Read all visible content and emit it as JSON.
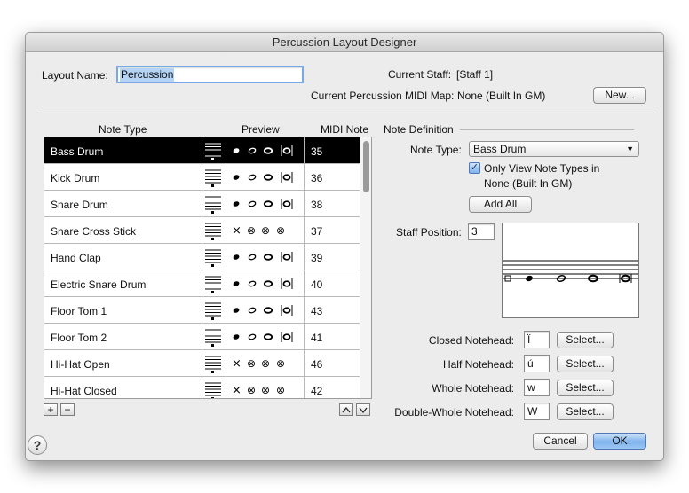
{
  "window": {
    "title": "Percussion Layout Designer"
  },
  "layout_name": {
    "label": "Layout Name:",
    "value": "Percussion"
  },
  "current_staff": {
    "label": "Current Staff:",
    "value": "[Staff 1]"
  },
  "midi_map": {
    "label": "Current Percussion MIDI Map:",
    "value": "None (Built In GM)",
    "new_button": "New..."
  },
  "table": {
    "headers": {
      "note_type": "Note Type",
      "preview": "Preview",
      "midi_note": "MIDI Note"
    },
    "rows": [
      {
        "name": "Bass Drum",
        "midi": "35",
        "preview": "normal",
        "selected": true
      },
      {
        "name": "Kick Drum",
        "midi": "36",
        "preview": "normal",
        "selected": false
      },
      {
        "name": "Snare Drum",
        "midi": "38",
        "preview": "normal",
        "selected": false
      },
      {
        "name": "Snare Cross Stick",
        "midi": "37",
        "preview": "x",
        "selected": false
      },
      {
        "name": "Hand Clap",
        "midi": "39",
        "preview": "normal",
        "selected": false
      },
      {
        "name": "Electric Snare Drum",
        "midi": "40",
        "preview": "normal",
        "selected": false
      },
      {
        "name": "Floor Tom 1",
        "midi": "43",
        "preview": "normal",
        "selected": false
      },
      {
        "name": "Floor Tom 2",
        "midi": "41",
        "preview": "normal",
        "selected": false
      },
      {
        "name": "Hi-Hat Open",
        "midi": "46",
        "preview": "x",
        "selected": false
      },
      {
        "name": "Hi-Hat Closed",
        "midi": "42",
        "preview": "x",
        "selected": false
      }
    ],
    "add_icon": "+",
    "remove_icon": "−",
    "move_up_icon": "chevron-up-icon",
    "move_down_icon": "chevron-down-icon"
  },
  "note_definition": {
    "title": "Note Definition",
    "note_type_label": "Note Type:",
    "note_type_value": "Bass Drum",
    "only_view_label_line1": "Only View Note Types in",
    "only_view_label_line2": "None (Built In GM)",
    "only_view_checked": true,
    "add_all_button": "Add All",
    "staff_position_label": "Staff Position:",
    "staff_position_value": "3",
    "noteheads": [
      {
        "label": "Closed Notehead:",
        "value": "Ï",
        "button": "Select..."
      },
      {
        "label": "Half Notehead:",
        "value": "ú",
        "button": "Select..."
      },
      {
        "label": "Whole Notehead:",
        "value": "w",
        "button": "Select..."
      },
      {
        "label": "Double-Whole Notehead:",
        "value": "W",
        "button": "Select..."
      }
    ]
  },
  "footer": {
    "help_icon": "?",
    "cancel_button": "Cancel",
    "ok_button": "OK"
  },
  "colors": {
    "selection": "#000000",
    "default_button": "#7fb3ec",
    "window_bg": "#ececec"
  }
}
